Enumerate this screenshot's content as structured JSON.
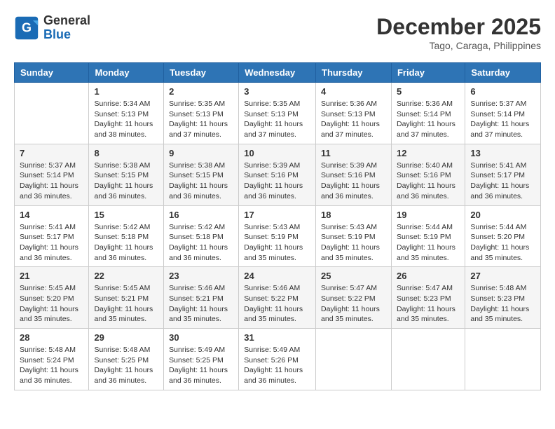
{
  "header": {
    "logo_line1": "General",
    "logo_line2": "Blue",
    "title": "December 2025",
    "subtitle": "Tago, Caraga, Philippines"
  },
  "days_of_week": [
    "Sunday",
    "Monday",
    "Tuesday",
    "Wednesday",
    "Thursday",
    "Friday",
    "Saturday"
  ],
  "weeks": [
    [
      {
        "day": "",
        "sunrise": "",
        "sunset": "",
        "daylight": ""
      },
      {
        "day": "1",
        "sunrise": "Sunrise: 5:34 AM",
        "sunset": "Sunset: 5:13 PM",
        "daylight": "Daylight: 11 hours and 38 minutes."
      },
      {
        "day": "2",
        "sunrise": "Sunrise: 5:35 AM",
        "sunset": "Sunset: 5:13 PM",
        "daylight": "Daylight: 11 hours and 37 minutes."
      },
      {
        "day": "3",
        "sunrise": "Sunrise: 5:35 AM",
        "sunset": "Sunset: 5:13 PM",
        "daylight": "Daylight: 11 hours and 37 minutes."
      },
      {
        "day": "4",
        "sunrise": "Sunrise: 5:36 AM",
        "sunset": "Sunset: 5:13 PM",
        "daylight": "Daylight: 11 hours and 37 minutes."
      },
      {
        "day": "5",
        "sunrise": "Sunrise: 5:36 AM",
        "sunset": "Sunset: 5:14 PM",
        "daylight": "Daylight: 11 hours and 37 minutes."
      },
      {
        "day": "6",
        "sunrise": "Sunrise: 5:37 AM",
        "sunset": "Sunset: 5:14 PM",
        "daylight": "Daylight: 11 hours and 37 minutes."
      }
    ],
    [
      {
        "day": "7",
        "sunrise": "Sunrise: 5:37 AM",
        "sunset": "Sunset: 5:14 PM",
        "daylight": "Daylight: 11 hours and 36 minutes."
      },
      {
        "day": "8",
        "sunrise": "Sunrise: 5:38 AM",
        "sunset": "Sunset: 5:15 PM",
        "daylight": "Daylight: 11 hours and 36 minutes."
      },
      {
        "day": "9",
        "sunrise": "Sunrise: 5:38 AM",
        "sunset": "Sunset: 5:15 PM",
        "daylight": "Daylight: 11 hours and 36 minutes."
      },
      {
        "day": "10",
        "sunrise": "Sunrise: 5:39 AM",
        "sunset": "Sunset: 5:16 PM",
        "daylight": "Daylight: 11 hours and 36 minutes."
      },
      {
        "day": "11",
        "sunrise": "Sunrise: 5:39 AM",
        "sunset": "Sunset: 5:16 PM",
        "daylight": "Daylight: 11 hours and 36 minutes."
      },
      {
        "day": "12",
        "sunrise": "Sunrise: 5:40 AM",
        "sunset": "Sunset: 5:16 PM",
        "daylight": "Daylight: 11 hours and 36 minutes."
      },
      {
        "day": "13",
        "sunrise": "Sunrise: 5:41 AM",
        "sunset": "Sunset: 5:17 PM",
        "daylight": "Daylight: 11 hours and 36 minutes."
      }
    ],
    [
      {
        "day": "14",
        "sunrise": "Sunrise: 5:41 AM",
        "sunset": "Sunset: 5:17 PM",
        "daylight": "Daylight: 11 hours and 36 minutes."
      },
      {
        "day": "15",
        "sunrise": "Sunrise: 5:42 AM",
        "sunset": "Sunset: 5:18 PM",
        "daylight": "Daylight: 11 hours and 36 minutes."
      },
      {
        "day": "16",
        "sunrise": "Sunrise: 5:42 AM",
        "sunset": "Sunset: 5:18 PM",
        "daylight": "Daylight: 11 hours and 36 minutes."
      },
      {
        "day": "17",
        "sunrise": "Sunrise: 5:43 AM",
        "sunset": "Sunset: 5:19 PM",
        "daylight": "Daylight: 11 hours and 35 minutes."
      },
      {
        "day": "18",
        "sunrise": "Sunrise: 5:43 AM",
        "sunset": "Sunset: 5:19 PM",
        "daylight": "Daylight: 11 hours and 35 minutes."
      },
      {
        "day": "19",
        "sunrise": "Sunrise: 5:44 AM",
        "sunset": "Sunset: 5:19 PM",
        "daylight": "Daylight: 11 hours and 35 minutes."
      },
      {
        "day": "20",
        "sunrise": "Sunrise: 5:44 AM",
        "sunset": "Sunset: 5:20 PM",
        "daylight": "Daylight: 11 hours and 35 minutes."
      }
    ],
    [
      {
        "day": "21",
        "sunrise": "Sunrise: 5:45 AM",
        "sunset": "Sunset: 5:20 PM",
        "daylight": "Daylight: 11 hours and 35 minutes."
      },
      {
        "day": "22",
        "sunrise": "Sunrise: 5:45 AM",
        "sunset": "Sunset: 5:21 PM",
        "daylight": "Daylight: 11 hours and 35 minutes."
      },
      {
        "day": "23",
        "sunrise": "Sunrise: 5:46 AM",
        "sunset": "Sunset: 5:21 PM",
        "daylight": "Daylight: 11 hours and 35 minutes."
      },
      {
        "day": "24",
        "sunrise": "Sunrise: 5:46 AM",
        "sunset": "Sunset: 5:22 PM",
        "daylight": "Daylight: 11 hours and 35 minutes."
      },
      {
        "day": "25",
        "sunrise": "Sunrise: 5:47 AM",
        "sunset": "Sunset: 5:22 PM",
        "daylight": "Daylight: 11 hours and 35 minutes."
      },
      {
        "day": "26",
        "sunrise": "Sunrise: 5:47 AM",
        "sunset": "Sunset: 5:23 PM",
        "daylight": "Daylight: 11 hours and 35 minutes."
      },
      {
        "day": "27",
        "sunrise": "Sunrise: 5:48 AM",
        "sunset": "Sunset: 5:23 PM",
        "daylight": "Daylight: 11 hours and 35 minutes."
      }
    ],
    [
      {
        "day": "28",
        "sunrise": "Sunrise: 5:48 AM",
        "sunset": "Sunset: 5:24 PM",
        "daylight": "Daylight: 11 hours and 36 minutes."
      },
      {
        "day": "29",
        "sunrise": "Sunrise: 5:48 AM",
        "sunset": "Sunset: 5:25 PM",
        "daylight": "Daylight: 11 hours and 36 minutes."
      },
      {
        "day": "30",
        "sunrise": "Sunrise: 5:49 AM",
        "sunset": "Sunset: 5:25 PM",
        "daylight": "Daylight: 11 hours and 36 minutes."
      },
      {
        "day": "31",
        "sunrise": "Sunrise: 5:49 AM",
        "sunset": "Sunset: 5:26 PM",
        "daylight": "Daylight: 11 hours and 36 minutes."
      },
      {
        "day": "",
        "sunrise": "",
        "sunset": "",
        "daylight": ""
      },
      {
        "day": "",
        "sunrise": "",
        "sunset": "",
        "daylight": ""
      },
      {
        "day": "",
        "sunrise": "",
        "sunset": "",
        "daylight": ""
      }
    ]
  ]
}
